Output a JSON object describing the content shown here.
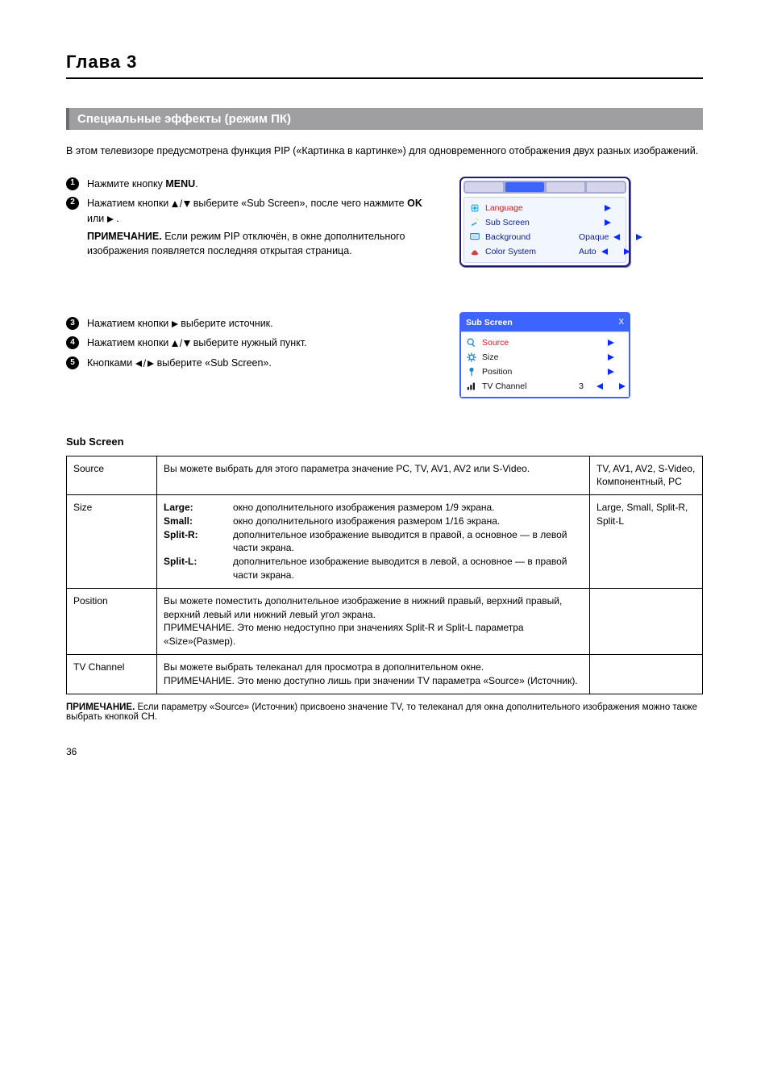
{
  "chapter": "Глава 3",
  "section_title": "Специальные эффекты (режим ПК)",
  "intro": "В этом телевизоре предусмотрена функция PIP («Картинка в картинке») для одновременного отображения двух разных изображений.",
  "steps": {
    "s1": {
      "text1": "Нажмите кнопку ",
      "btn": "MENU",
      "text2": "."
    },
    "s2": {
      "text1": "Нажатием кнопки ",
      "text2": " выберите «Sub Screen», после чего нажмите ",
      "kOK": "OK",
      "text3": " или ",
      "text4": ".",
      "note_label": "ПРИМЕЧАНИЕ.",
      "note_text": " Если режим PIP отключён, в окне дополнительного изображения появляется последняя открытая страница."
    },
    "s3": {
      "text1": "Нажатием кнопки ",
      "text2": " выберите источник."
    },
    "s4": {
      "text1": "Нажатием кнопки ",
      "text2": " выберите нужный пункт."
    },
    "s5": {
      "text1": "Кнопками ",
      "text2": " выберите «Sub Screen»."
    }
  },
  "menu_main": {
    "tabs": [
      "",
      "",
      "",
      ""
    ],
    "rows": [
      {
        "icon": "globe-icon",
        "label": "Language",
        "value": "",
        "arrows": "right",
        "first": true
      },
      {
        "icon": "wand-icon",
        "label": "Sub Screen",
        "value": "",
        "arrows": "right"
      },
      {
        "icon": "screen-icon",
        "label": "Background",
        "value": "Opaque",
        "arrows": "both"
      },
      {
        "icon": "hat-icon",
        "label": "Color System",
        "value": "Auto",
        "arrows": "both"
      }
    ]
  },
  "menu_sub": {
    "title": "Sub Screen",
    "close": "X",
    "rows": [
      {
        "icon": "magnifier-icon",
        "label": "Source",
        "value": "",
        "arrows": "right",
        "first": true
      },
      {
        "icon": "gear-icon",
        "label": "Size",
        "value": "",
        "arrows": "right"
      },
      {
        "icon": "pin-icon",
        "label": "Position",
        "value": "",
        "arrows": "right"
      },
      {
        "icon": "bars-icon",
        "label": "TV Channel",
        "value": "3",
        "arrows": "both"
      }
    ]
  },
  "table_title": "Sub Screen",
  "table": {
    "rows": [
      {
        "c1": "Source",
        "c2": "Вы можете выбрать для этого параметра значение PC, TV, AV1, AV2 или S-Video.",
        "c3": "TV, AV1, AV2, S-Video, Компонентный, PC"
      },
      {
        "c1": "Size",
        "c2_items": [
          {
            "tag": "Large:",
            "text": "окно дополнительного изображения размером 1/9 экрана."
          },
          {
            "tag": "Small:",
            "text": "окно дополнительного изображения размером 1/16 экрана."
          },
          {
            "tag": "Split-R:",
            "text": "дополнительное изображение выводится в правой, а основное — в левой части экрана."
          },
          {
            "tag": "Split-L:",
            "text": "дополнительное изображение выводится в левой, а основное — в правой части экрана."
          }
        ],
        "c3": "Large, Small, Split-R, Split-L"
      },
      {
        "c1": "Position",
        "c2": "Вы можете поместить дополнительное изображение в нижний правый, верхний правый, верхний левый или нижний левый угол экрана.\nПРИМЕЧАНИЕ. Это меню недоступно при значениях Split-R и Split-L параметра «Size»(Размер).",
        "c3": ""
      },
      {
        "c1": "TV Channel",
        "c2": "Вы можете выбрать телеканал для просмотра в дополнительном окне.\nПРИМЕЧАНИЕ. Это меню доступно лишь при значении TV параметра «Source» (Источник).",
        "c3": ""
      }
    ]
  },
  "footnote_label": "ПРИМЕЧАНИЕ.",
  "footnote_text": " Если параметру «Source» (Источник) присвоено значение TV, то телеканал для окна дополнительного изображения можно также выбрать кнопкой CH.",
  "page_number": "36"
}
